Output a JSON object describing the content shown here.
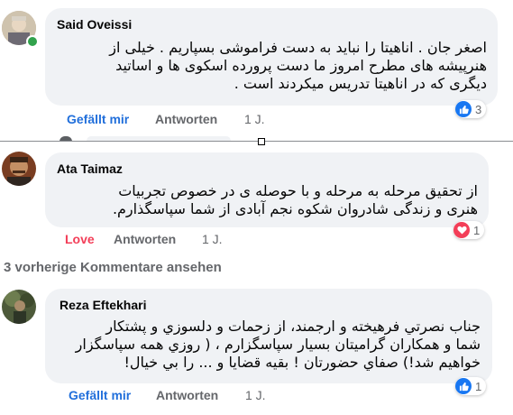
{
  "comments": [
    {
      "author": "Said Oveissi",
      "lines": [
        "اصغر جان . اناهیتا را نباید به دست فراموشی بسپاریم . خیلی از",
        "هنرپیشه های مطرح امروز ما دست پرورده اسکوی ها و اساتید",
        "دیگری که در اناهیتا تدریس میکردند است ."
      ],
      "reaction_label": "Gefällt mir",
      "reply_label": "Antworten",
      "time": "1 J.",
      "reaction_count": "3",
      "reaction_icon": "like-icon",
      "online": true
    },
    {
      "author": "Ata Taimaz",
      "lines": [
        "از تحقیق مرحله به مرحله و با حوصله ی در خصوص تجربیات",
        "هنری و زندگی شادروان شکوه نجم آبادی از شما سپاسگذارم."
      ],
      "reaction_label": "Love",
      "reply_label": "Antworten",
      "time": "1 J.",
      "reaction_count": "1",
      "reaction_icon": "heart-icon"
    },
    {
      "author": "Reza Eftekhari",
      "lines": [
        "جناب نصرتي فرهيخته و ارجمند، از زحمات و دلسوزي و پشتكار",
        "شما و همكاران گراميتان بسيار سپاسگزارم ، ( روزي همه سپاسگزار",
        "خواهيم شد!) صفاي حضورتان ! بقيه قضايا و ... را بي خيال!"
      ],
      "reaction_label": "Gefällt mir",
      "reply_label": "Antworten",
      "time": "1 J.",
      "reaction_count": "1",
      "reaction_icon": "like-icon"
    }
  ],
  "view_more": "3 vorherige Kommentare ansehen",
  "colors": {
    "bubble": "#f0f2f5",
    "like": "#216fdb",
    "love": "#f33e58",
    "muted": "#65676b",
    "online": "#31a24c"
  }
}
